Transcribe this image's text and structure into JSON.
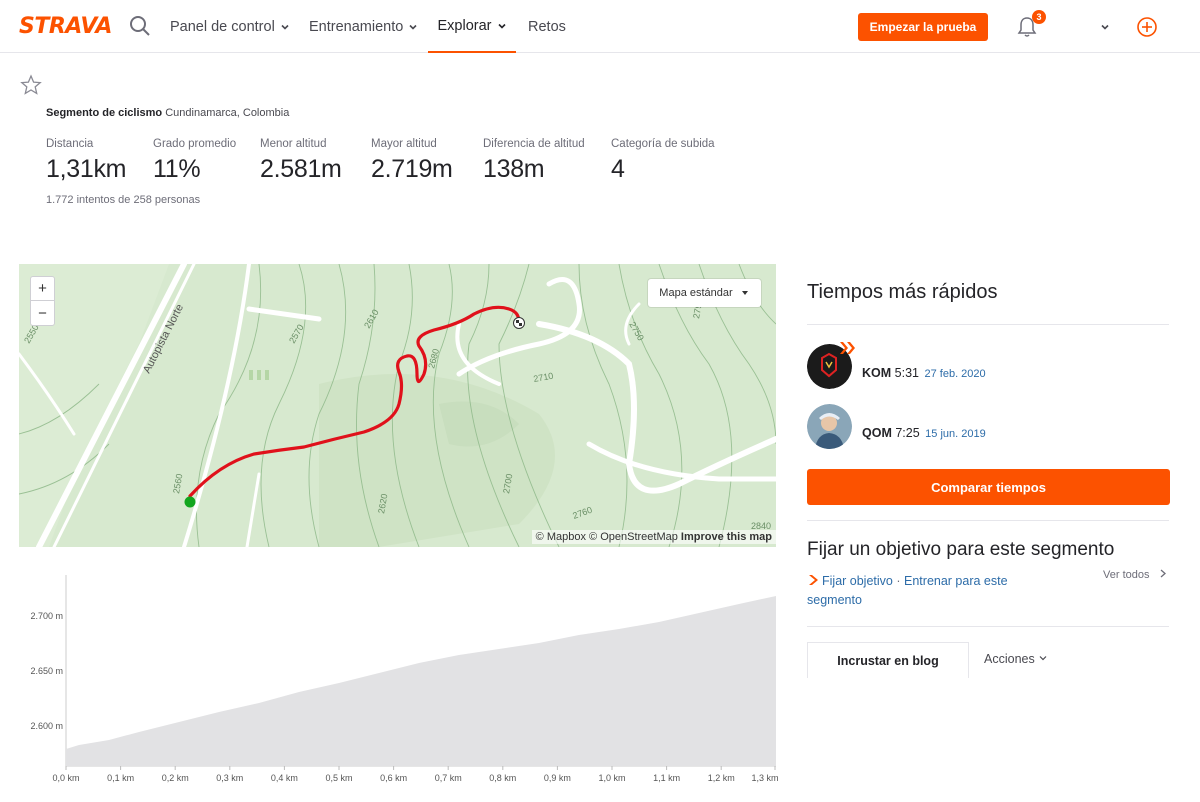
{
  "header": {
    "logo": "STRAVA",
    "nav": [
      {
        "label": "Panel de control",
        "has_menu": true
      },
      {
        "label": "Entrenamiento",
        "has_menu": true
      },
      {
        "label": "Explorar",
        "has_menu": true,
        "active": true
      },
      {
        "label": "Retos",
        "has_menu": false
      }
    ],
    "trial_button": "Empezar la prueba",
    "notifications_count": "3",
    "accent_color": "#fc5200"
  },
  "segment": {
    "type_label": "Segmento de ciclismo",
    "location": "Cundinamarca, Colombia",
    "stats": [
      {
        "label": "Distancia",
        "value": "1,31km"
      },
      {
        "label": "Grado promedio",
        "value": "11%"
      },
      {
        "label": "Menor altitud",
        "value": "2.581m"
      },
      {
        "label": "Mayor altitud",
        "value": "2.719m"
      },
      {
        "label": "Diferencia de altitud",
        "value": "138m"
      },
      {
        "label": "Categoría de subida",
        "value": "4"
      }
    ],
    "attempts": "1.772 intentos de 258 personas"
  },
  "map": {
    "zoom_in": "+",
    "zoom_out": "−",
    "map_type": "Mapa estándar",
    "attribution_mapbox": "© Mapbox",
    "attribution_osm": "© OpenStreetMap",
    "attribution_improve": "Improve this map",
    "road_label": "Autopista Norte",
    "contour_labels": [
      "2550",
      "2570",
      "2610",
      "2680",
      "2710",
      "2750",
      "2790",
      "2560",
      "2620",
      "2700",
      "2760",
      "2840"
    ]
  },
  "elevation": {
    "y_ticks": [
      "2.700 m",
      "2.650 m",
      "2.600 m"
    ],
    "x_ticks": [
      "0,0 km",
      "0,1 km",
      "0,2 km",
      "0,3 km",
      "0,4 km",
      "0,5 km",
      "0,6 km",
      "0,7 km",
      "0,8 km",
      "0,9 km",
      "1,0 km",
      "1,1 km",
      "1,2 km",
      "1,3 km"
    ]
  },
  "leaderboard": {
    "title": "Tiempos más rápidos",
    "entries": [
      {
        "rank": "KOM",
        "time": "5:31",
        "date": "27 feb. 2020"
      },
      {
        "rank": "QOM",
        "time": "7:25",
        "date": "15 jun. 2019"
      }
    ],
    "compare_button": "Comparar tiempos"
  },
  "goal": {
    "title": "Fijar un objetivo para este segmento",
    "link_set_goal": "Fijar objetivo",
    "separator": "·",
    "link_train": "Entrenar para este segmento",
    "see_all": "Ver todos"
  },
  "tabs": {
    "embed": "Incrustar en blog",
    "actions": "Acciones"
  }
}
